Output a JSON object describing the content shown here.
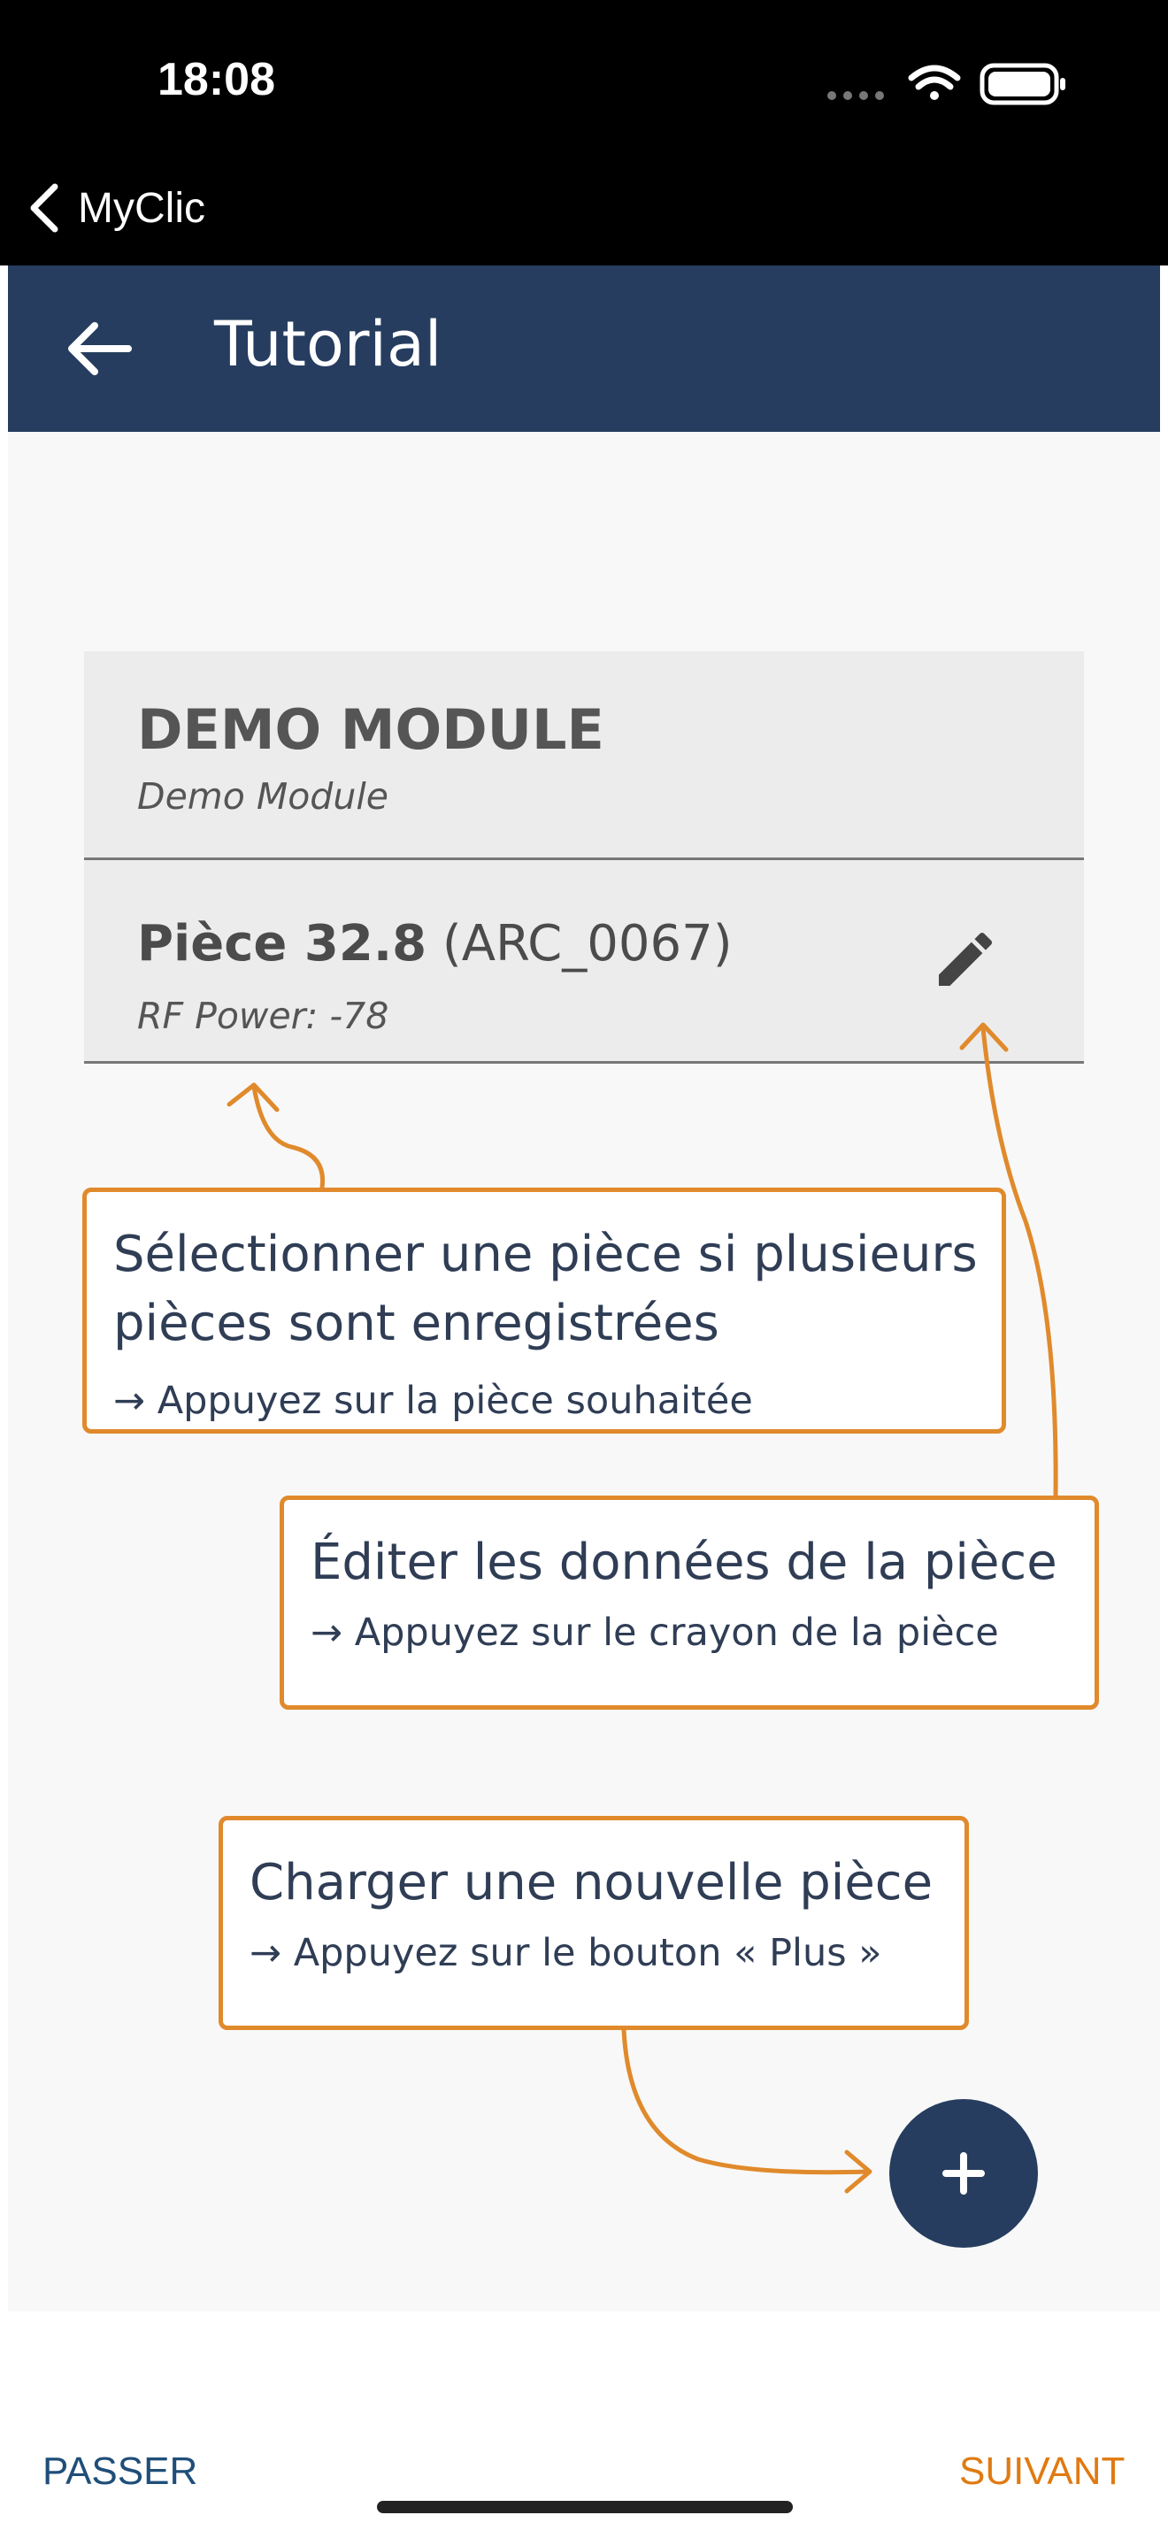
{
  "status_bar": {
    "time": "18:08"
  },
  "ios_nav": {
    "back_label": "MyClic"
  },
  "app_bar": {
    "title": "Tutorial"
  },
  "module": {
    "name": "DEMO MODULE",
    "subtitle": "Demo Module",
    "piece": {
      "title": "Pièce 32.8",
      "code": "(ARC_0067)",
      "rf_power": "RF Power: -78"
    }
  },
  "callouts": {
    "select": {
      "title_line1": "Sélectionner une pièce si plusieurs",
      "title_line2": "pièces sont enregistrées",
      "hint": "→ Appuyez sur la pièce souhaitée"
    },
    "edit": {
      "title": "Éditer les données de la pièce",
      "hint": "→ Appuyez sur le crayon de la pièce"
    },
    "add": {
      "title": "Charger une nouvelle pièce",
      "hint": "→ Appuyez sur le bouton « Plus »"
    }
  },
  "footer": {
    "skip_label": "PASSER",
    "next_label": "SUIVANT"
  },
  "colors": {
    "primary": "#263d5f",
    "accent": "#e08a2c",
    "next": "#e07a12",
    "skip": "#1f4e79"
  },
  "icons": [
    "chevron-left-icon",
    "arrow-left-icon",
    "pencil-icon",
    "plus-icon",
    "signal-icon",
    "wifi-icon",
    "battery-icon"
  ]
}
